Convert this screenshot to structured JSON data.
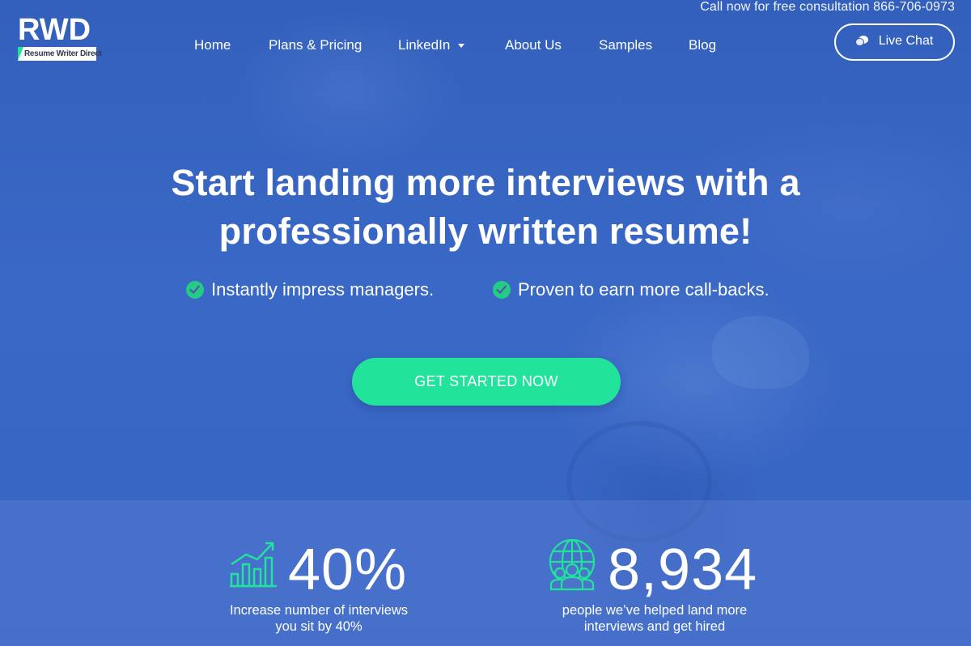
{
  "header": {
    "logo": {
      "letters": "RWD",
      "tagline": "Resume Writer Direct"
    },
    "consultation_text": "Call now for free consultation 866-706-0973",
    "nav": [
      {
        "label": "Home"
      },
      {
        "label": "Plans & Pricing"
      },
      {
        "label": "LinkedIn",
        "has_dropdown": true
      },
      {
        "label": "About Us"
      },
      {
        "label": "Samples"
      },
      {
        "label": "Blog"
      }
    ],
    "live_chat": {
      "label": "Live Chat",
      "icon": "chat-bubble-icon"
    }
  },
  "hero": {
    "headline_line1": "Start landing more interviews with a",
    "headline_line2": "professionally written resume!",
    "benefits": [
      {
        "icon": "check-circle-icon",
        "text": "Instantly impress managers."
      },
      {
        "icon": "check-circle-icon",
        "text": "Proven to earn more call-backs."
      }
    ],
    "cta_label": "GET STARTED NOW"
  },
  "stats": [
    {
      "icon": "growth-chart-icon",
      "value": "40%",
      "desc_line1": "Increase number of interviews",
      "desc_line2": "you sit by 40%"
    },
    {
      "icon": "globe-people-icon",
      "value": "8,934",
      "desc_line1": "people we’ve helped land more",
      "desc_line2": "interviews and get hired"
    }
  ],
  "colors": {
    "background_blue": "#3561bd",
    "accent_green": "#22e39a",
    "check_green": "#22cc84",
    "text": "#ffffff"
  }
}
